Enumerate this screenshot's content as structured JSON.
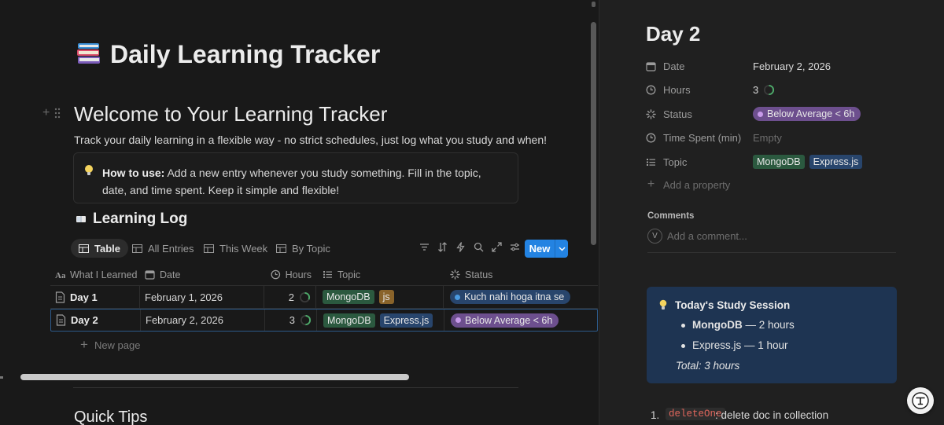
{
  "page": {
    "title": "Daily Learning Tracker",
    "icon": "books-icon"
  },
  "welcome": {
    "heading": "Welcome to Your Learning Tracker",
    "intro": "Track your daily learning in a flexible way - no strict schedules, just log what you study and when!",
    "callout_bold": "How to use:",
    "callout_text": " Add a new entry whenever you study something. Fill in the topic, date, and time spent. Keep it simple and flexible!"
  },
  "log": {
    "title": "Learning Log",
    "tabs": [
      {
        "label": "Table",
        "active": true
      },
      {
        "label": "All Entries",
        "active": false
      },
      {
        "label": "This Week",
        "active": false
      },
      {
        "label": "By Topic",
        "active": false
      }
    ],
    "new_label": "New",
    "new_page_label": "New page",
    "columns": [
      "What I Learned",
      "Date",
      "Hours",
      "Topic",
      "Status"
    ],
    "rows": [
      {
        "name": "Day 1",
        "date": "February 1, 2026",
        "hours": "2",
        "hours_fraction": 0.33,
        "topics": [
          {
            "label": "MongoDB",
            "color": "green"
          },
          {
            "label": "js",
            "color": "brown"
          }
        ],
        "status": {
          "label": "Kuch nahi hoga itna se",
          "color": "blue"
        }
      },
      {
        "name": "Day 2",
        "date": "February 2, 2026",
        "hours": "3",
        "hours_fraction": 0.5,
        "topics": [
          {
            "label": "MongoDB",
            "color": "green"
          },
          {
            "label": "Express.js",
            "color": "blue"
          }
        ],
        "status": {
          "label": "Below Average < 6h",
          "color": "purple"
        }
      }
    ]
  },
  "quick_tips": {
    "heading": "Quick Tips"
  },
  "side_panel": {
    "title": "Day 2",
    "properties": [
      {
        "key": "Date",
        "icon": "calendar-icon",
        "value": "February 2, 2026"
      },
      {
        "key": "Hours",
        "icon": "clock-icon",
        "value": "3"
      },
      {
        "key": "Status",
        "icon": "status-icon",
        "value": "Below Average < 6h"
      },
      {
        "key": "Time Spent (min)",
        "icon": "clock-icon",
        "value": "Empty"
      },
      {
        "key": "Topic",
        "icon": "list-icon",
        "tags": [
          "MongoDB",
          "Express.js"
        ]
      }
    ],
    "add_property": "Add a property",
    "comments_label": "Comments",
    "avatar_letter": "V",
    "comment_placeholder": "Add a comment...",
    "session": {
      "title": "Today's Study Session",
      "items": [
        {
          "bold": "MongoDB",
          "text": " — 2 hours"
        },
        {
          "bold": "",
          "text": "Express.js — 1 hour"
        }
      ],
      "total": "Total: 3 hours"
    },
    "list": {
      "number": "1.",
      "code": "deleteOne",
      "text": ": delete doc in collection"
    }
  },
  "colors": {
    "accent": "#2383e2",
    "tag_green": "#2b593f",
    "tag_blue": "#28456c",
    "tag_brown": "#89632a",
    "status_purple": "#6d4f8e",
    "callout_blue": "#1e3452"
  }
}
